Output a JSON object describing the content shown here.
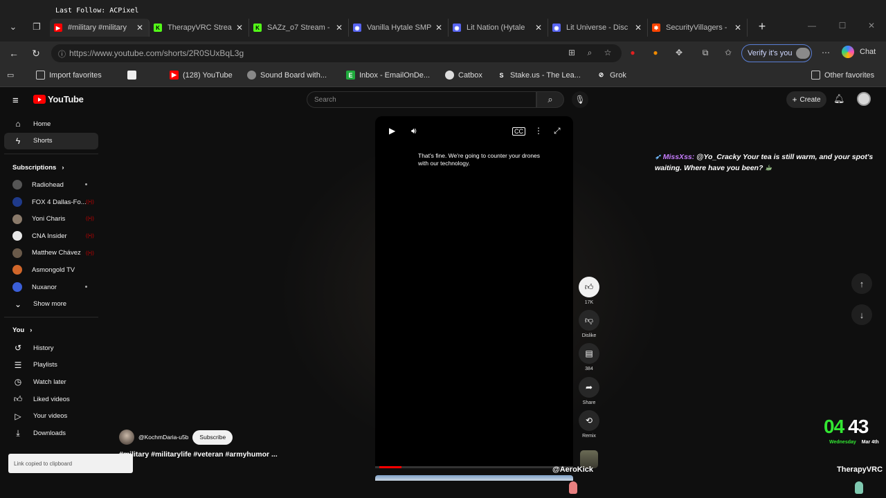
{
  "overlay": {
    "last_follow": "Last Follow: ACPixel",
    "chat": {
      "user": "MissXss:",
      "message": "@Yo_Cracky Your tea is still warm, and your spot's waiting. Where have you been?"
    },
    "clock": {
      "hours": "04",
      "minutes": "43",
      "weekday": "Wednesday",
      "date": "Mar 4th"
    },
    "streamer_left": "@AeroKick",
    "streamer_right": "TherapyVRC"
  },
  "browser": {
    "tabs": [
      {
        "title": "#military #military",
        "color": "#ff0000",
        "glyph": "▶"
      },
      {
        "title": "TherapyVRC Strea",
        "color": "#53fc18",
        "glyph": "K"
      },
      {
        "title": "SAZz_o7 Stream -",
        "color": "#53fc18",
        "glyph": "K"
      },
      {
        "title": "Vanilla Hytale SMP",
        "color": "#5865f2",
        "glyph": "◉"
      },
      {
        "title": "Lit Nation (Hytale",
        "color": "#5865f2",
        "glyph": "◉"
      },
      {
        "title": "Lit Universe - Disc",
        "color": "#5865f2",
        "glyph": "◉"
      },
      {
        "title": "SecurityVillagers -",
        "color": "#ff4400",
        "glyph": "✱"
      }
    ],
    "url": "https://www.youtube.com/shorts/2R0SUxBqL3g",
    "verify_label": "Verify it's you",
    "chat_label": "Chat",
    "bookmarks": [
      {
        "label": "Import favorites"
      },
      {
        "label": "(128) YouTube"
      },
      {
        "label": "Sound Board with..."
      },
      {
        "label": "Inbox - EmailOnDe..."
      },
      {
        "label": "Catbox"
      },
      {
        "label": "Stake.us - The Lea..."
      },
      {
        "label": "Grok"
      }
    ],
    "other_favorites": "Other favorites"
  },
  "youtube": {
    "logo_text": "YouTube",
    "search_placeholder": "Search",
    "create_label": "Create",
    "nav": [
      {
        "label": "Home"
      },
      {
        "label": "Shorts"
      }
    ],
    "subscriptions_label": "Subscriptions",
    "subscriptions": [
      {
        "label": "Radiohead",
        "color": "#555"
      },
      {
        "label": "FOX 4 Dallas-Fo...",
        "color": "#1f3a8a"
      },
      {
        "label": "Yoni Charis",
        "color": "#8a7a6a"
      },
      {
        "label": "CNA Insider",
        "color": "#e8e8e8"
      },
      {
        "label": "Matthew Chávez",
        "color": "#6a5a4a"
      },
      {
        "label": "Asmongold TV",
        "color": "#d0662a"
      },
      {
        "label": "Nuxanor",
        "color": "#3b5fd8"
      }
    ],
    "show_more": "Show more",
    "you_label": "You",
    "you_items": [
      {
        "label": "History"
      },
      {
        "label": "Playlists"
      },
      {
        "label": "Watch later"
      },
      {
        "label": "Liked videos"
      },
      {
        "label": "Your videos"
      },
      {
        "label": "Downloads"
      }
    ],
    "video": {
      "caption": "That's fine. We're going to counter your drones with our technology.",
      "channel": "@KochmDaria-u5b",
      "subscribe": "Subscribe",
      "hashtags": "#military #militarylife #veteran #armyhumor ..."
    },
    "actions": {
      "likes": "17K",
      "dislike": "Dislike",
      "comments": "384",
      "share": "Share",
      "remix": "Remix"
    },
    "toast": "Link copied to clipboard"
  }
}
